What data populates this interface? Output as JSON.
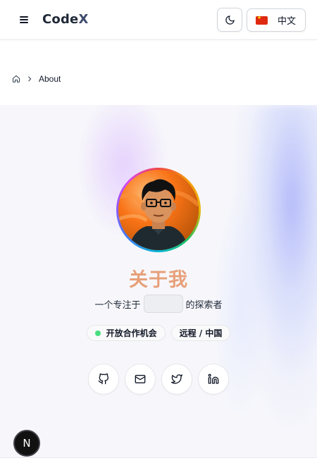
{
  "header": {
    "brand_prefix": "Code",
    "brand_suffix": "X",
    "menu_icon": "hamburger-icon",
    "theme_icon": "moon-icon",
    "language": {
      "flag": "china-flag-icon",
      "label": "中文"
    }
  },
  "breadcrumb": {
    "home_icon": "home-icon",
    "separator_icon": "chevron-right-icon",
    "current": "About"
  },
  "profile": {
    "title": "关于我",
    "tagline_prefix": "一个专注于",
    "tagline_suffix": "的探索者",
    "badges": [
      {
        "label": "开放合作机会",
        "status_color": "#4ade80"
      },
      {
        "label": "远程 / 中国"
      }
    ],
    "socials": [
      {
        "icon": "github-icon"
      },
      {
        "icon": "mail-icon"
      },
      {
        "icon": "twitter-icon"
      },
      {
        "icon": "linkedin-icon"
      }
    ]
  },
  "dev_badge": {
    "label": "N"
  },
  "colors": {
    "title": "#e7a07a",
    "status_dot": "#4ade80",
    "accent_blue": "#818cf8",
    "accent_purple": "#d8b4fe"
  }
}
